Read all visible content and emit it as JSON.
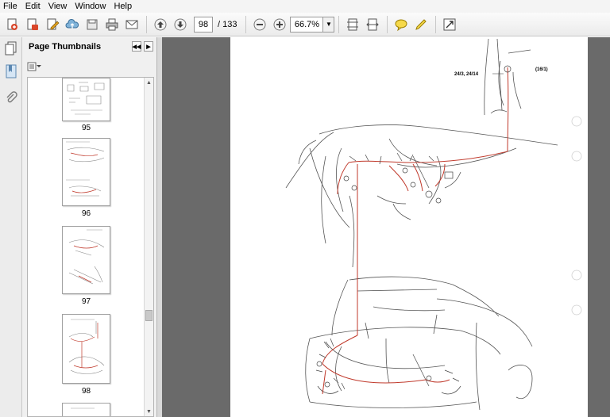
{
  "menu": [
    "File",
    "Edit",
    "View",
    "Window",
    "Help"
  ],
  "toolbar": {
    "page_number": "98",
    "page_total": "/ 133",
    "zoom": "66.7%",
    "icons": [
      "create-pdf-icon",
      "open-icon",
      "edit-icon",
      "cloud-upload-icon",
      "save-icon",
      "print-icon",
      "email-icon",
      "previous-page-icon",
      "next-page-icon",
      "zoom-out-icon",
      "zoom-in-icon",
      "fit-page-icon",
      "fit-width-icon",
      "comment-icon",
      "highlight-icon",
      "full-screen-icon"
    ]
  },
  "panel": {
    "title": "Page Thumbnails",
    "thumbnails": [
      {
        "label": "95"
      },
      {
        "label": "96"
      },
      {
        "label": "97"
      },
      {
        "label": "98"
      }
    ]
  },
  "document": {
    "callout_left": "24/3, 24/14",
    "callout_right": "(16/1)"
  },
  "colors": {
    "document_background": "#6a6a6a",
    "wire": "#c0392b"
  }
}
